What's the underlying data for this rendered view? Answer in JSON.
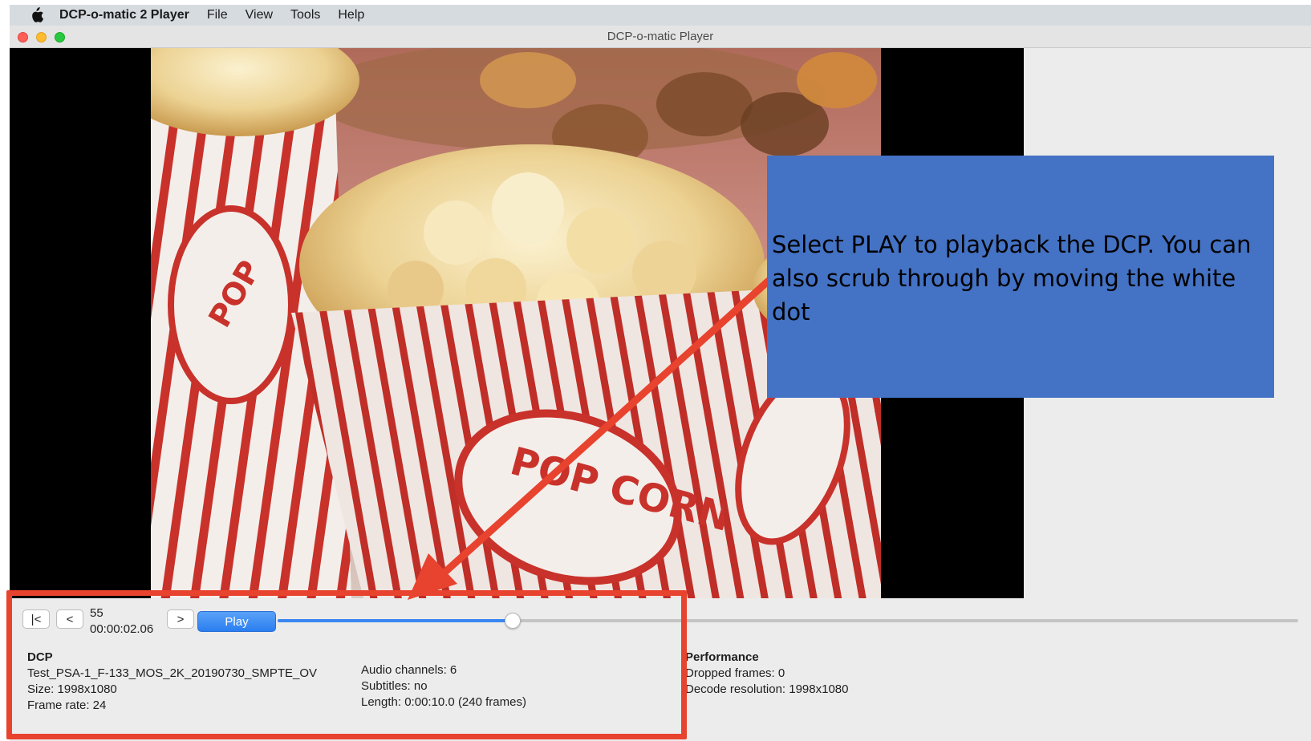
{
  "menubar": {
    "app_name": "DCP-o-matic 2 Player",
    "menus": [
      "File",
      "View",
      "Tools",
      "Help"
    ]
  },
  "window": {
    "title": "DCP-o-matic Player"
  },
  "controls": {
    "go_start_label": "|<",
    "back_label": "<",
    "forward_label": ">",
    "play_label": "Play",
    "frame_number": "55",
    "timecode": "00:00:02.06",
    "playback_position_fraction": 0.23
  },
  "info": {
    "dcp_heading": "DCP",
    "dcp_name": "Test_PSA-1_F-133_MOS_2K_20190730_SMPTE_OV",
    "size": "Size: 1998x1080",
    "frame_rate": "Frame rate: 24",
    "audio_channels": "Audio channels: 6",
    "subtitles": "Subtitles: no",
    "length": "Length: 0:00:10.0 (240 frames)",
    "performance_heading": "Performance",
    "dropped_frames": "Dropped frames: 0",
    "decode_resolution": "Decode resolution: 1998x1080"
  },
  "annotation": {
    "callout_text": "Select PLAY to playback the DCP. You can also scrub through by moving the white dot",
    "callout_color": "#4472c4",
    "highlight_color": "#e8432e"
  },
  "colors": {
    "play_button": "#2a7ef0",
    "slider_progress": "#3a86f0"
  },
  "video": {
    "subject": "popcorn-boxes",
    "box_text": "POP CORN"
  }
}
